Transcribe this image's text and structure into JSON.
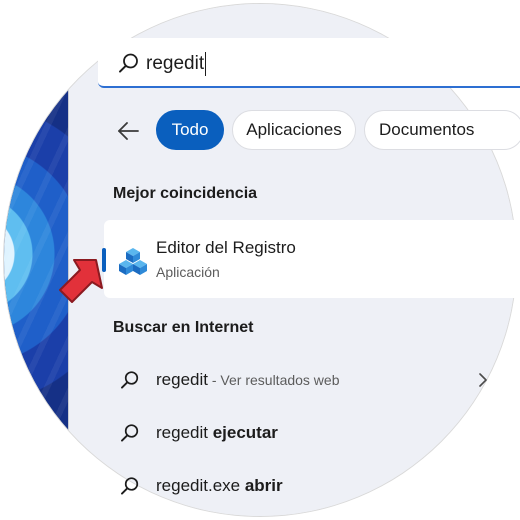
{
  "search": {
    "query": "regedit"
  },
  "filters": {
    "all": "Todo",
    "apps": "Aplicaciones",
    "docs": "Documentos"
  },
  "best_match": {
    "section_title": "Mejor coincidencia",
    "app_name": "Editor del Registro",
    "app_type": "Aplicación"
  },
  "internet": {
    "section_title": "Buscar en Internet",
    "results": [
      {
        "term": "regedit",
        "suffix": " - Ver resultados web",
        "bold_part": ""
      },
      {
        "term": "regedit ",
        "suffix": "",
        "bold_part": "ejecutar"
      },
      {
        "term": "regedit.exe ",
        "suffix": "",
        "bold_part": "abrir"
      }
    ]
  },
  "colors": {
    "accent": "#0a5fbe",
    "pointer": "#e2313a"
  }
}
